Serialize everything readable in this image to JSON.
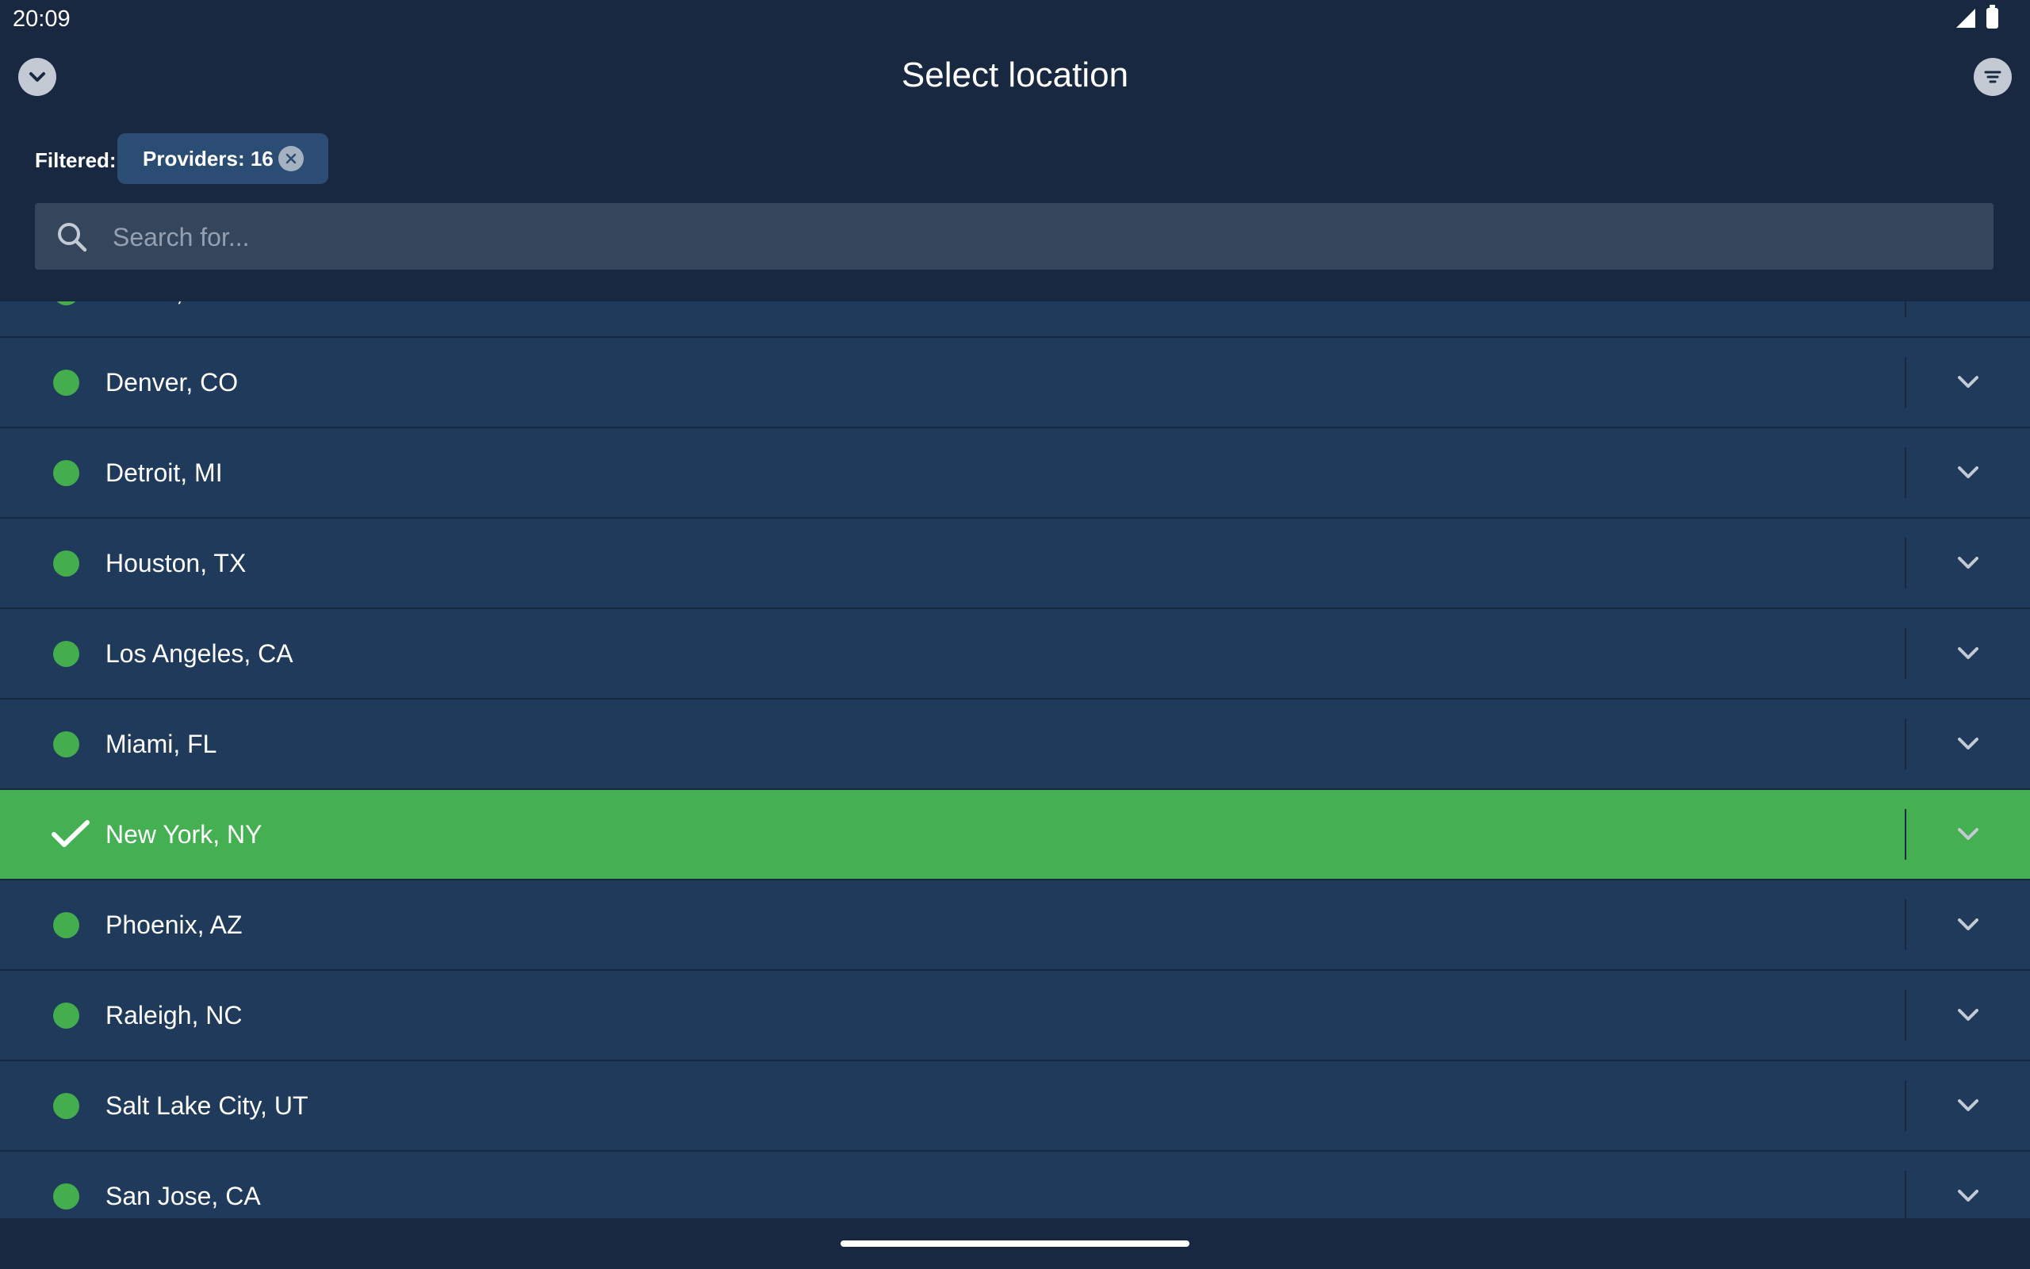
{
  "status_bar": {
    "time": "20:09"
  },
  "header": {
    "title": "Select location"
  },
  "filter": {
    "label": "Filtered:",
    "chip_label": "Providers: 16"
  },
  "search": {
    "placeholder": "Search for..."
  },
  "locations": [
    {
      "name": "Dallas, TX",
      "selected": false
    },
    {
      "name": "Denver, CO",
      "selected": false
    },
    {
      "name": "Detroit, MI",
      "selected": false
    },
    {
      "name": "Houston, TX",
      "selected": false
    },
    {
      "name": "Los Angeles, CA",
      "selected": false
    },
    {
      "name": "Miami, FL",
      "selected": false
    },
    {
      "name": "New York, NY",
      "selected": true
    },
    {
      "name": "Phoenix, AZ",
      "selected": false
    },
    {
      "name": "Raleigh, NC",
      "selected": false
    },
    {
      "name": "Salt Lake City, UT",
      "selected": false
    },
    {
      "name": "San Jose, CA",
      "selected": false
    }
  ],
  "colors": {
    "background": "#192841",
    "row": "#1f3a5b",
    "selected_row": "#44b052",
    "status_dot": "#44ad4d",
    "chip": "#2c4d73",
    "search_box": "#34465c"
  },
  "icons": {
    "back": "chevron-down-circle-icon",
    "filter": "filter-icon",
    "chip_close": "close-circle-icon",
    "search": "search-icon",
    "row_expand": "chevron-down-icon",
    "selected": "checkmark-icon",
    "online": "status-dot-icon"
  }
}
